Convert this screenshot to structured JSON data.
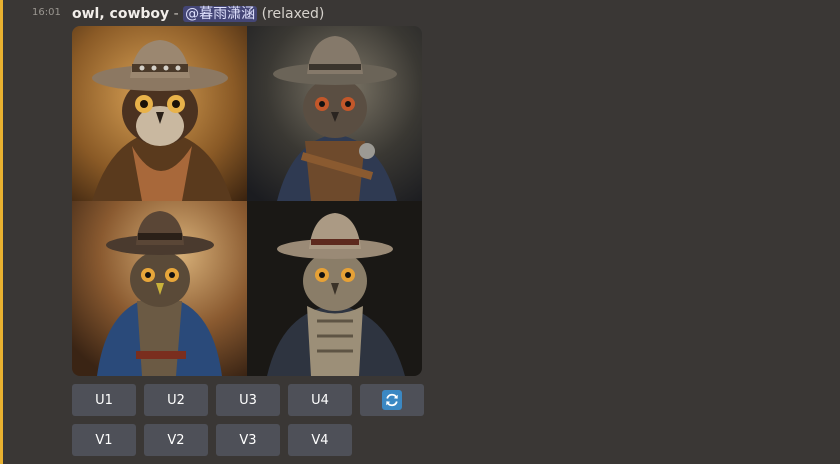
{
  "message": {
    "timestamp": "16:01",
    "prompt": "owl, cowboy",
    "separator": " - ",
    "mention": "@暮雨潇涵",
    "mode": "(relaxed)"
  },
  "image_grid": {
    "tiles": [
      {
        "subject": "owl-cowboy-warm-tan"
      },
      {
        "subject": "owl-cowboy-dark-navy"
      },
      {
        "subject": "owl-cowboy-blue-jacket"
      },
      {
        "subject": "owl-cowboy-black-bg"
      }
    ]
  },
  "buttons": {
    "upscale": [
      "U1",
      "U2",
      "U3",
      "U4"
    ],
    "variation": [
      "V1",
      "V2",
      "V3",
      "V4"
    ],
    "reroll_icon": "refresh-icon"
  },
  "colors": {
    "background": "#3a3735",
    "button": "#4e5058",
    "accent_bar": "#e8b130",
    "mention_bg": "#5865f2",
    "reroll_icon": "#3b88c3"
  }
}
